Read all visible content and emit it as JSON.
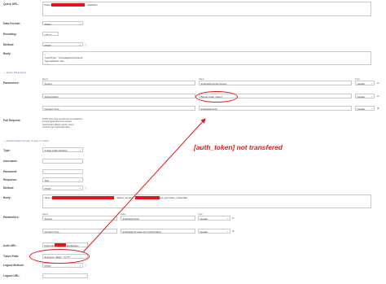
{
  "labels": {
    "query_url": "Query URL:",
    "data_format": "Data Format:",
    "encoding": "Encoding:",
    "method": "Method:",
    "body": "Body:",
    "parameters": "Parameters:",
    "full_request": "Full Request:",
    "type": "Type:",
    "username": "Username:",
    "password": "Password:",
    "response": "Response:",
    "method2": "Method:",
    "body2": "Body:",
    "parameters2": "Parameters:",
    "auth_url": "Auth URL:",
    "token_path": "Token Path:",
    "logout_method": "Logout Method:",
    "logout_url": "Logout URL:"
  },
  "query": {
    "url_prefix": "https://",
    "url_suffix": "/statistics",
    "data_format": "JSON",
    "encoding": "UTF-8",
    "method": "POST",
    "body_lines": [
      "{",
      "  \"reportType\": \"CampaignPerformance\",",
      "  \"ignoreGlobal\": true,",
      "  \"...\": ..."
    ]
  },
  "query_params_section": "— Query Parameters",
  "param_headers": {
    "name": "Name",
    "value": "Value",
    "type": "Type"
  },
  "query_params": [
    {
      "name": "Accept",
      "value": "application/octet-stream",
      "type": "Header"
    },
    {
      "name": "Authorization",
      "value": "Bearer [auth_token]",
      "type": "Header"
    },
    {
      "name": "Content-Type",
      "value": "application/json",
      "type": "Header"
    }
  ],
  "full_request_lines": [
    "POST https://api.yourdomain.com/statistics",
    "Accept:application/octet-stream",
    "Authorization:Bearer [auth_token]",
    "Content-Type:application/json"
  ],
  "auth_section": "— Authentication (2-step, 3-step, or basic)",
  "auth": {
    "type": "2-Step Authentication",
    "response": "Text",
    "method": "POST",
    "body_client_id": "client_id=",
    "body_client_secret": "&client_secret=",
    "body_grant": "&grant_type=client_credentials",
    "auth_url_prefix": "https://ap",
    "auth_url_suffix": "/auth/token",
    "token_path": "$.access_token\", \"0.??\"",
    "logout_method": "POST"
  },
  "auth_params": [
    {
      "name": "Accept",
      "value": "application/json",
      "type": "Header"
    },
    {
      "name": "Content-Type",
      "value": "application/x-www-form-urlencoded",
      "type": "Header"
    }
  ],
  "annotation": "[auth_token] not transfered",
  "colors": {
    "annotation": "#e01b1b",
    "redaction": "#e8101b",
    "link": "#4a7bc1"
  }
}
